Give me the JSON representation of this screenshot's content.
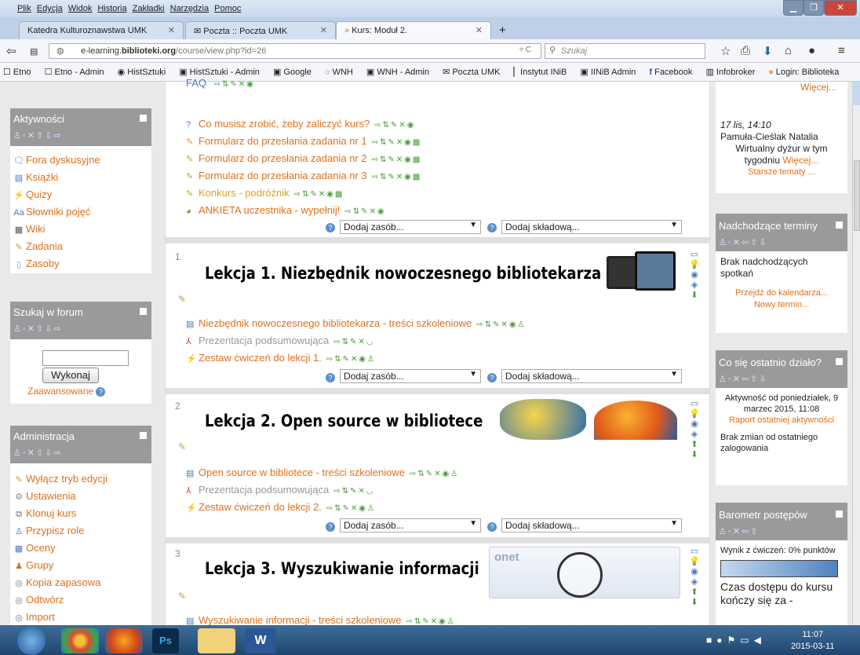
{
  "menubar": {
    "items": [
      "Plik",
      "Edycja",
      "Widok",
      "Historia",
      "Zakładki",
      "Narzędzia",
      "Pomoc"
    ]
  },
  "tabs": [
    {
      "label": "Katedra Kulturoznawstwa UMK"
    },
    {
      "label": "Poczta :: Poczta UMK"
    },
    {
      "label": "Kurs: Moduł 2."
    }
  ],
  "nav": {
    "url_host": "e-learning.",
    "url_domain": "biblioteki.org",
    "url_path": "/course/view.php?id=26",
    "search_placeholder": "Szukaj"
  },
  "bookmarks": [
    "Etno",
    "Etno - Admin",
    "HistSztuki",
    "HistSztuki - Admin",
    "Google",
    "WNH",
    "WNH - Admin",
    "Poczta UMK",
    "Instytut INiB",
    "IINiB Admin",
    "Facebook",
    "Infobroker",
    "Login: Biblioteka"
  ],
  "left": {
    "aktywnosci": {
      "title": "Aktywności",
      "items": [
        "Fora dyskusyjne",
        "Książki",
        "Quizy",
        "Słowniki pojęć",
        "Wiki",
        "Zadania",
        "Zasoby"
      ]
    },
    "szukaj": {
      "title": "Szukaj w forum",
      "button": "Wykonaj",
      "advanced": "Zaawansowane"
    },
    "admin": {
      "title": "Administracja",
      "items": [
        "Wyłącz tryb edycji",
        "Ustawienia",
        "Klonuj kurs",
        "Przypisz role",
        "Oceny",
        "Grupy",
        "Kopia zapasowa",
        "Odtwórz",
        "Import"
      ]
    }
  },
  "center": {
    "top_items": [
      "Co musisz zrobić, żeby zaliczyć kurs?",
      "Formularz do przesłania zadania nr 1",
      "Formularz do przesłania zadania nr 2",
      "Formularz do przesłania zadania nr 3",
      "Konkurs - podróżnik",
      "ANKIETA uczestnika - wypełnij!"
    ],
    "add_resource": "Dodaj zasób...",
    "add_activity": "Dodaj składową...",
    "sections": [
      {
        "num": "1",
        "title": "Lekcja 1. Niezbędnik nowoczesnego bibliotekarza",
        "items": [
          "Niezbędnik nowoczesnego bibliotekarza - treści szkoleniowe",
          "Prezentacja podsumowująca",
          "Zestaw ćwiczeń do lekcji 1."
        ]
      },
      {
        "num": "2",
        "title": "Lekcja 2. Open source w bibliotece",
        "items": [
          "Open source w bibliotece - treści szkoleniowe",
          "Prezentacja podsumowująca",
          "Zestaw ćwiczeń do lekcji 2."
        ]
      },
      {
        "num": "3",
        "title": "Lekcja 3. Wyszukiwanie informacji",
        "items": [
          "Wyszukiwanie informacji - treści szkoleniowe"
        ]
      }
    ]
  },
  "right": {
    "news": {
      "more": "Więcej...",
      "date": "17 lis, 14:10",
      "author": "Pamuła-Cieślak Natalia",
      "text": "Wirtualny dyżur w tym tygodniu",
      "more2": "Więcej...",
      "older": "Starsze tematy ..."
    },
    "events": {
      "title": "Nadchodzące terminy",
      "text": "Brak nadchodzących spotkań",
      "calendar": "Przejdź do kalendarza...",
      "new": "Nowy termin..."
    },
    "recent": {
      "title": "Co się ostatnio działo?",
      "since": "Aktywność od poniedziałek, 9 marzec 2015, 11:08",
      "report": "Raport ostatniej aktywności",
      "nochange": "Brak zmian od ostatniego zalogowania"
    },
    "progress": {
      "title": "Barometr postępów",
      "result": "Wynik z ćwiczeń: 0% punktów",
      "access": "Czas dostępu do kursu kończy się za -"
    }
  },
  "taskbar": {
    "time": "11:07",
    "date": "2015-03-11"
  }
}
